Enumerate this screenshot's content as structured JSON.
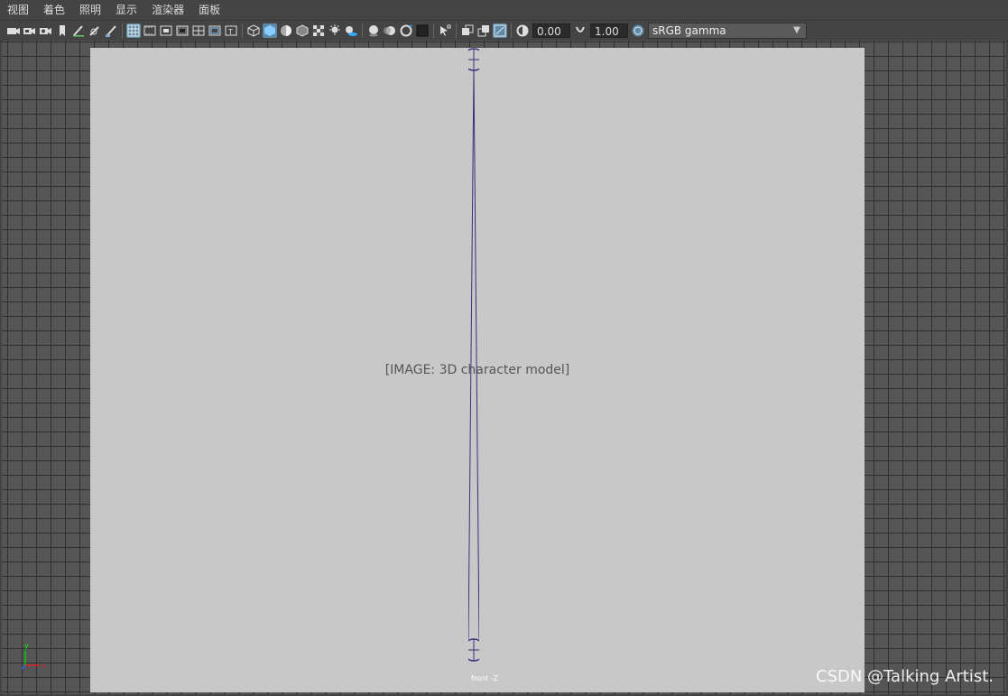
{
  "menu": {
    "items": [
      "视图",
      "着色",
      "照明",
      "显示",
      "渲染器",
      "面板"
    ]
  },
  "toolbar": {
    "exposure_value": "0.00",
    "gamma_value": "1.00",
    "color_space": "sRGB gamma"
  },
  "viewport": {
    "camera_label": "front -Z",
    "axis_y_label": "y",
    "axis_x_label": "x",
    "watermark": "CSDN @Talking Artist."
  },
  "colors": {
    "active_icon": "#5d8aa8",
    "grid_line": "#2f2f2f",
    "viewport_bg": "#555555",
    "joint_color": "#3a2f7a"
  },
  "icons": [
    "camera-icon",
    "camera-attributes-icon",
    "camera-bookmark-icon",
    "bookmark-icon",
    "pen-icon",
    "grid-snap-icon",
    "brush-icon",
    "grid-toggle-icon",
    "film-gate-icon",
    "resolution-gate-icon",
    "gate-mask-icon",
    "field-chart-icon",
    "safe-action-icon",
    "safe-title-icon",
    "wireframe-icon",
    "smooth-shade-icon",
    "shade-default-icon",
    "wireframe-on-shaded-icon",
    "xray-icon",
    "lights-icon",
    "shadows-icon",
    "screen-space-ao-icon",
    "motion-blur-icon",
    "anti-alias-icon",
    "depth-of-field-icon",
    "isolate-select-icon",
    "xray-joints-icon",
    "xray-active-icon",
    "backface-icon",
    "exposure-icon",
    "gamma-icon",
    "color-management-icon"
  ]
}
